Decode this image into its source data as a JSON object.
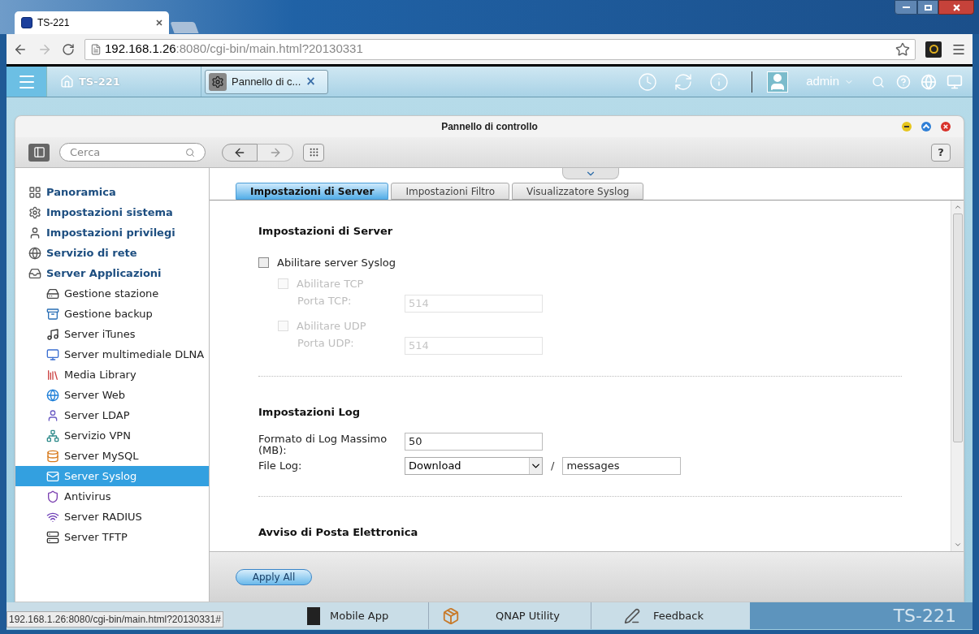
{
  "browser": {
    "tab_title": "TS-221",
    "url_host": "192.168.1.26",
    "url_rest": ":8080/cgi-bin/main.html?20130331"
  },
  "topbar": {
    "home_label": "TS-221",
    "open_app": "Pannello di c...",
    "close_glyph": "×",
    "user": "admin"
  },
  "window": {
    "title": "Pannello di controllo",
    "search": {
      "placeholder": "Cerca"
    },
    "help": "?"
  },
  "sidebar": {
    "items": [
      {
        "kind": "category",
        "label": "Panoramica",
        "selected": false
      },
      {
        "kind": "category",
        "label": "Impostazioni sistema",
        "selected": false
      },
      {
        "kind": "category",
        "label": "Impostazioni privilegi",
        "selected": false
      },
      {
        "kind": "category",
        "label": "Servizio di rete",
        "selected": false
      },
      {
        "kind": "category",
        "label": "Server Applicazioni",
        "selected": false
      },
      {
        "kind": "app",
        "label": "Gestione stazione",
        "selected": false
      },
      {
        "kind": "app",
        "label": "Gestione backup",
        "selected": false
      },
      {
        "kind": "app",
        "label": "Server iTunes",
        "selected": false
      },
      {
        "kind": "app",
        "label": "Server multimediale DLNA",
        "selected": false
      },
      {
        "kind": "app",
        "label": "Media Library",
        "selected": false
      },
      {
        "kind": "app",
        "label": "Server Web",
        "selected": false
      },
      {
        "kind": "app",
        "label": "Server LDAP",
        "selected": false
      },
      {
        "kind": "app",
        "label": "Servizio VPN",
        "selected": false
      },
      {
        "kind": "app",
        "label": "Server MySQL",
        "selected": false
      },
      {
        "kind": "app",
        "label": "Server Syslog",
        "selected": true
      },
      {
        "kind": "app",
        "label": "Antivirus",
        "selected": false
      },
      {
        "kind": "app",
        "label": "Server RADIUS",
        "selected": false
      },
      {
        "kind": "app",
        "label": "Server TFTP",
        "selected": false
      }
    ]
  },
  "tabs": [
    {
      "label": "Impostazioni di Server",
      "selected": true
    },
    {
      "label": "Impostazioni Filtro",
      "selected": false
    },
    {
      "label": "Visualizzatore Syslog",
      "selected": false
    }
  ],
  "sections": [
    {
      "title": "Impostazioni di Server",
      "rows": [
        {
          "kind": "checkbox",
          "label": "Abilitare server Syslog",
          "checked": false,
          "disabled": false
        },
        {
          "kind": "sub_checkbox",
          "label": "Abilitare TCP",
          "checked": false,
          "disabled": true
        },
        {
          "kind": "sub_field",
          "label": "Porta TCP:",
          "value": "514",
          "disabled": true
        },
        {
          "kind": "sub_checkbox",
          "label": "Abilitare UDP",
          "checked": false,
          "disabled": true
        },
        {
          "kind": "sub_field",
          "label": "Porta UDP:",
          "value": "514",
          "disabled": true
        }
      ]
    },
    {
      "title": "Impostazioni Log",
      "rows": [
        {
          "kind": "field",
          "label": "Formato di Log Massimo (MB):",
          "value": "50",
          "disabled": false
        },
        {
          "kind": "file",
          "label": "File Log:",
          "value": "Download",
          "separator": "/",
          "file": "messages"
        }
      ]
    },
    {
      "title": "Avviso di Posta Elettronica"
    }
  ],
  "footer": {
    "apply": "Apply All"
  },
  "taskbar": [
    {
      "label": "Mobile App"
    },
    {
      "label": "QNAP Utility"
    },
    {
      "label": "Feedback"
    }
  ],
  "brand": "TS-221",
  "status_url": "192.168.1.26:8080/cgi-bin/main.html?20130331#"
}
